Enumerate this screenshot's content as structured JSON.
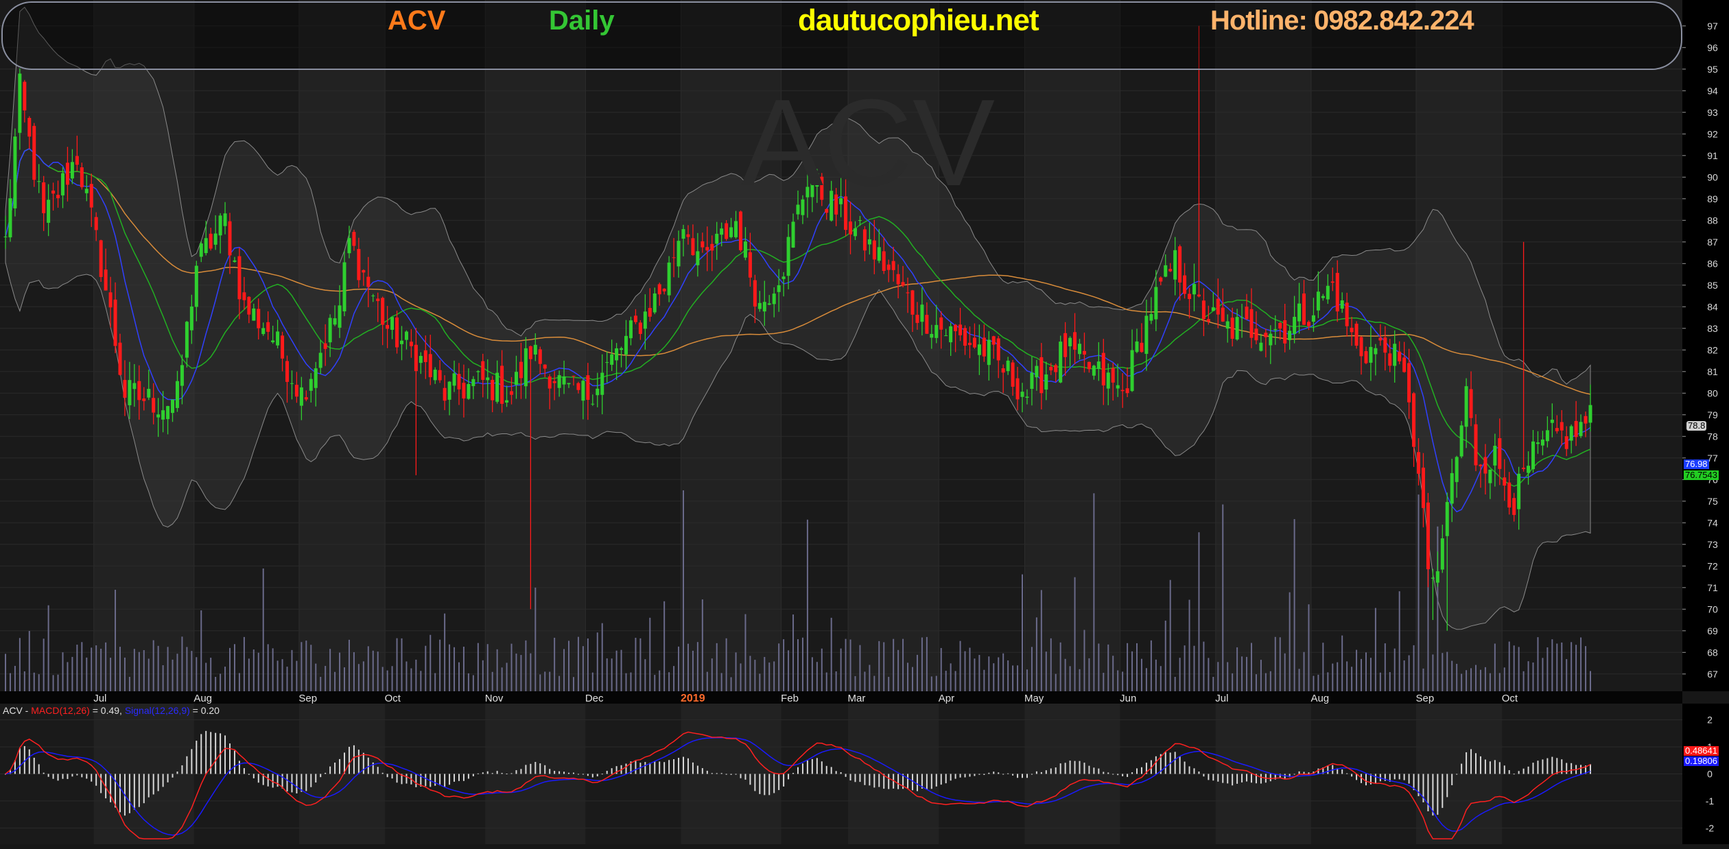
{
  "header": {
    "symbol": "ACV",
    "period": "Daily",
    "site": "dautucophieu.net",
    "hotline": "Hotline: 0982.842.224"
  },
  "watermark": "ACV",
  "colors": {
    "symbol": "#ff7a1a",
    "period": "#34c634",
    "site": "#ffff00",
    "hotline": "#ffb36b",
    "up_candle": "#2fcf2f",
    "down_candle": "#ff1a1a",
    "ma20": "#22b022",
    "ma10": "#3040ff",
    "ma200": "#d98c3a",
    "bollinger": "#8a8a8a",
    "volume": "#6a6a8a",
    "macd": "#ff2020",
    "signal": "#1a1aff",
    "histogram": "#d8d8d8"
  },
  "chart_data": [
    {
      "type": "candlestick",
      "ticker": "ACV",
      "y_ticks": [
        67,
        68,
        69,
        70,
        71,
        72,
        73,
        74,
        75,
        76,
        77,
        78,
        79,
        80,
        81,
        82,
        83,
        84,
        85,
        86,
        87,
        88,
        89,
        90,
        91,
        92,
        93,
        94,
        95,
        96,
        97
      ],
      "ylim": [
        66.2,
        98.2
      ],
      "x_labels": [
        "Jul",
        "Aug",
        "Sep",
        "Oct",
        "Nov",
        "Dec",
        "2019",
        "Feb",
        "Mar",
        "Apr",
        "May",
        "Jun",
        "Jul",
        "Aug",
        "Sep",
        "Oct"
      ],
      "x_label_bars": [
        19,
        40,
        62,
        80,
        101,
        122,
        142,
        163,
        177,
        196,
        214,
        234,
        254,
        274,
        296,
        314
      ],
      "n_bars": 333,
      "close_anchors": [
        [
          0,
          87
        ],
        [
          3,
          94
        ],
        [
          8,
          88
        ],
        [
          15,
          91
        ],
        [
          20,
          86
        ],
        [
          25,
          80
        ],
        [
          33,
          79.5
        ],
        [
          36,
          79.8
        ],
        [
          40,
          86
        ],
        [
          46,
          88
        ],
        [
          50,
          84
        ],
        [
          55,
          83
        ],
        [
          62,
          80
        ],
        [
          70,
          84
        ],
        [
          72,
          87
        ],
        [
          80,
          83
        ],
        [
          86,
          81.8
        ],
        [
          92,
          80
        ],
        [
          100,
          80.5
        ],
        [
          106,
          80
        ],
        [
          110,
          82
        ],
        [
          118,
          80
        ],
        [
          122,
          80
        ],
        [
          127,
          81.5
        ],
        [
          132,
          83
        ],
        [
          138,
          85
        ],
        [
          142,
          88
        ],
        [
          146,
          86
        ],
        [
          153,
          88
        ],
        [
          158,
          84
        ],
        [
          163,
          86
        ],
        [
          168,
          90
        ],
        [
          172,
          89
        ],
        [
          176,
          88
        ],
        [
          184,
          86
        ],
        [
          190,
          84
        ],
        [
          196,
          83
        ],
        [
          205,
          82
        ],
        [
          214,
          80
        ],
        [
          222,
          82
        ],
        [
          228,
          81
        ],
        [
          234,
          80
        ],
        [
          240,
          84
        ],
        [
          245,
          86
        ],
        [
          250,
          84
        ],
        [
          255,
          83
        ],
        [
          262,
          83
        ],
        [
          268,
          83
        ],
        [
          274,
          84
        ],
        [
          278,
          85
        ],
        [
          283,
          82
        ],
        [
          290,
          82
        ],
        [
          294,
          80
        ],
        [
          298,
          72
        ],
        [
          300,
          71
        ],
        [
          302,
          75
        ],
        [
          304,
          77
        ],
        [
          306,
          80
        ],
        [
          308,
          77
        ],
        [
          312,
          77
        ],
        [
          316,
          75
        ],
        [
          320,
          77
        ],
        [
          324,
          78
        ],
        [
          328,
          78
        ],
        [
          333,
          79
        ]
      ],
      "last_price": "78.8",
      "ma_badges": [
        "76.98",
        "76.7543"
      ],
      "spikes": [
        {
          "bar": 110,
          "low": 70
        },
        {
          "bar": 250,
          "high": 97
        },
        {
          "bar": 318,
          "high": 87
        },
        {
          "bar": 299,
          "low": 69.5
        },
        {
          "bar": 302,
          "low": 69
        },
        {
          "bar": 86,
          "low": 76.2
        }
      ]
    },
    {
      "type": "line",
      "title": "ACV - MACD(12,26) = 0.49, Signal(12,26,9) = 0.20",
      "series": [
        {
          "name": "MACD(12,26)",
          "last": 0.49
        },
        {
          "name": "Signal(12,26,9)",
          "last": 0.2
        }
      ],
      "y_ticks": [
        -2,
        -1,
        0,
        1,
        2
      ],
      "ylim": [
        -2.6,
        2.6
      ],
      "badges": [
        "0.48641",
        "0.19806"
      ]
    }
  ],
  "macd_legend": {
    "prefix": "ACV - ",
    "macd_name": "MACD(12,26)",
    "macd_value": " = 0.49, ",
    "signal_name": "Signal(12,26,9)",
    "signal_value": " = 0.20"
  }
}
